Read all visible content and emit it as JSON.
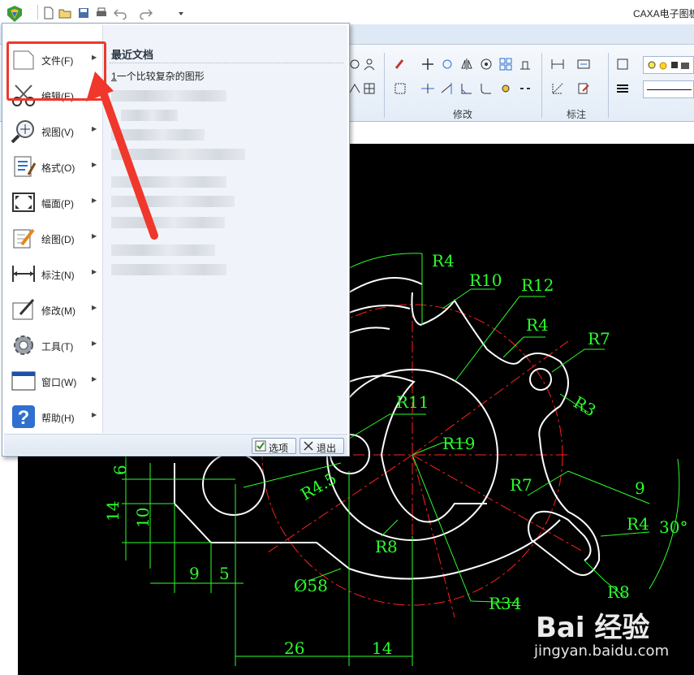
{
  "app": {
    "title": "CAXA电子图板"
  },
  "ribbon": {
    "groups": [
      {
        "label": "修改"
      },
      {
        "label": "标注"
      }
    ]
  },
  "menu": {
    "items": [
      {
        "label": "文件(F)",
        "icon": "blank-document-icon"
      },
      {
        "label": "编辑(E)",
        "icon": "scissors-icon"
      },
      {
        "label": "视图(V)",
        "icon": "zoom-icon"
      },
      {
        "label": "格式(O)",
        "icon": "format-icon"
      },
      {
        "label": "幅面(P)",
        "icon": "frame-icon"
      },
      {
        "label": "绘图(D)",
        "icon": "pencil-icon"
      },
      {
        "label": "标注(N)",
        "icon": "dimension-icon"
      },
      {
        "label": "修改(M)",
        "icon": "modify-icon"
      },
      {
        "label": "工具(T)",
        "icon": "gear-icon"
      },
      {
        "label": "窗口(W)",
        "icon": "window-icon"
      },
      {
        "label": "帮助(H)",
        "icon": "help-icon"
      }
    ],
    "recent": {
      "title": "最近文档",
      "first_index": "1",
      "first_name": "一个比较复杂的图形"
    },
    "footer": {
      "options_label": "选项",
      "exit_label": "退出"
    },
    "highlight_color": "#f0372b"
  },
  "drawing": {
    "labels": [
      "R4",
      "R10",
      "R12",
      "R4",
      "R7",
      "R3",
      "R11",
      "R19",
      "R4.5",
      "R7",
      "9",
      "R4",
      "30°",
      "R8",
      "R8",
      "R34",
      "Ø58",
      "6",
      "14",
      "10",
      "9",
      "5",
      "26",
      "14"
    ],
    "colors": {
      "background": "#000000",
      "geometry": "#ffffff",
      "dimension": "#2bff2b",
      "centerline": "#ff2020"
    }
  },
  "watermark": {
    "brand": "Bai 经验",
    "url": "jingyan.baidu.com"
  }
}
